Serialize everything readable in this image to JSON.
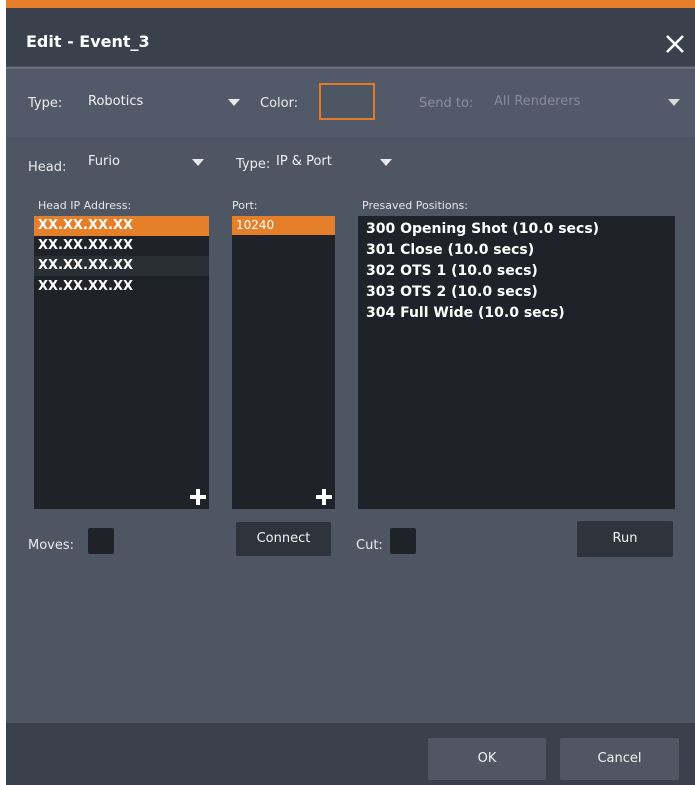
{
  "dialog": {
    "title": "Edit - Event_3",
    "accent_color": "#e57f2a"
  },
  "top_row": {
    "type_label": "Type:",
    "type_value": "Robotics",
    "color_label": "Color:",
    "send_to_label": "Send to:",
    "send_to_value": "All Renderers"
  },
  "head_row": {
    "head_label": "Head:",
    "head_value": "Furio",
    "type_label": "Type:",
    "type_value": "IP & Port"
  },
  "columns": {
    "ip_header": "Head IP Address:",
    "port_header": "Port:",
    "presaved_header": "Presaved Positions:"
  },
  "ip_addresses": [
    "XX.XX.XX.XX",
    "XX.XX.XX.XX",
    "XX.XX.XX.XX",
    "XX.XX.XX.XX"
  ],
  "ports": [
    "10240"
  ],
  "presaved_positions": [
    "300 Opening Shot (10.0 secs)",
    "301 Close (10.0 secs)",
    "302 OTS 1 (10.0 secs)",
    "303 OTS 2 (10.0 secs)",
    "304 Full Wide (10.0 secs)"
  ],
  "controls": {
    "moves_label": "Moves:",
    "connect_label": "Connect",
    "cut_label": "Cut:",
    "run_label": "Run"
  },
  "footer": {
    "ok_label": "OK",
    "cancel_label": "Cancel"
  },
  "icons": {
    "close": "close-icon",
    "add_ip": "plus-icon",
    "add_port": "plus-icon",
    "dropdown": "chevron-down-icon"
  }
}
